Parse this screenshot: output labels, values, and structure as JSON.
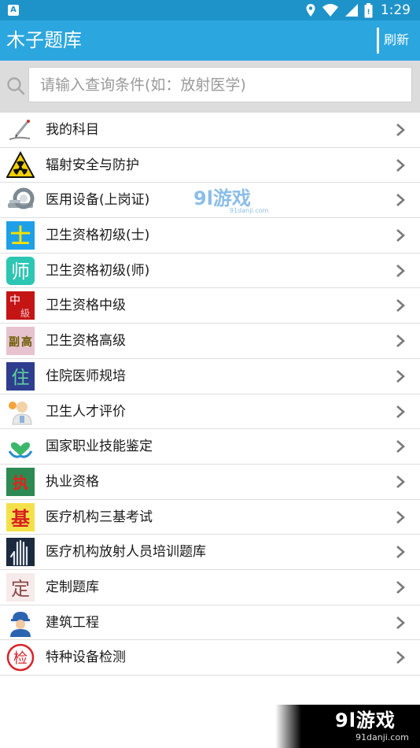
{
  "status_bar": {
    "notification_letter": "A",
    "time": "1:29",
    "icons": [
      "location-icon",
      "wifi-icon",
      "signal-icon",
      "battery-icon"
    ]
  },
  "app_bar": {
    "title": "木子题库",
    "refresh_label": "刷新"
  },
  "search": {
    "placeholder": "请输入查询条件(如：放射医学)"
  },
  "list": {
    "items": [
      {
        "label": "我的科目",
        "icon": "pen-icon"
      },
      {
        "label": "辐射安全与防护",
        "icon": "radiation-icon"
      },
      {
        "label": "医用设备(上岗证)",
        "icon": "medical-device-icon"
      },
      {
        "label": "卫生资格初级(士)",
        "icon": "health-junior-shi-icon"
      },
      {
        "label": "卫生资格初级(师)",
        "icon": "health-junior-shi2-icon"
      },
      {
        "label": "卫生资格中级",
        "icon": "health-intermediate-icon"
      },
      {
        "label": "卫生资格高级",
        "icon": "health-senior-icon"
      },
      {
        "label": "住院医师规培",
        "icon": "resident-doctor-icon"
      },
      {
        "label": "卫生人才评价",
        "icon": "talent-evaluation-icon"
      },
      {
        "label": "国家职业技能鉴定",
        "icon": "vocational-skill-icon"
      },
      {
        "label": "执业资格",
        "icon": "practice-qualification-icon"
      },
      {
        "label": "医疗机构三基考试",
        "icon": "three-basics-icon"
      },
      {
        "label": "医疗机构放射人员培训题库",
        "icon": "xray-hand-icon"
      },
      {
        "label": "定制题库",
        "icon": "custom-bank-icon"
      },
      {
        "label": "建筑工程",
        "icon": "construction-worker-icon"
      },
      {
        "label": "特种设备检测",
        "icon": "inspection-stamp-icon"
      }
    ]
  },
  "watermark": {
    "brand": "9l游戏",
    "url": "91danji.com",
    "mid_brand": "9l游戏",
    "mid_url": "91danji.com"
  },
  "colors": {
    "status_bar": "#1e93c9",
    "app_bar": "#2ba6df",
    "search_bg": "#dcdcdc",
    "divider": "#dedede"
  }
}
